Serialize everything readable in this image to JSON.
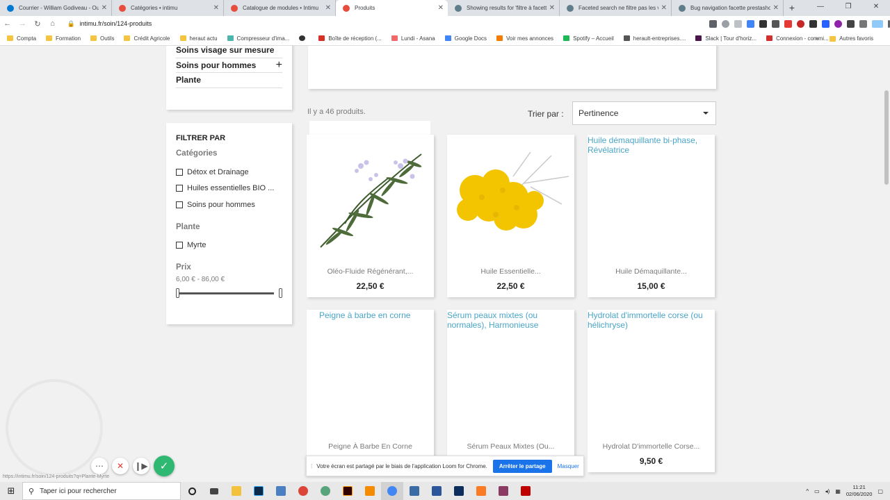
{
  "browser": {
    "tabs": [
      {
        "title": "Courrier - William Godiveau - Ou",
        "color": "#0078d4"
      },
      {
        "title": "Catégories • intimu",
        "color": "#e74c3c"
      },
      {
        "title": "Catalogue de modules • Intimu",
        "color": "#e74c3c"
      },
      {
        "title": "Produits",
        "color": "#e74c3c"
      },
      {
        "title": "Showing results for 'filtre à facett",
        "color": "#607d8b"
      },
      {
        "title": "Faceted search ne filtre pas les var",
        "color": "#607d8b"
      },
      {
        "title": "Bug navigation facette prestasho",
        "color": "#607d8b"
      }
    ],
    "active_tab": 3,
    "url": "intimu.fr/soin/124-produits",
    "bookmarks": [
      "Compta",
      "Formation",
      "Outils",
      "Crédit Agricole",
      "heraut actu",
      "Compresseur d'ima...",
      "",
      "Boîte de réception (...",
      "Lundi - Asana",
      "Google Docs",
      "Voir mes annonces",
      "Spotify – Accueil",
      "herault-entreprises....",
      "Slack | Tour d'horiz...",
      "Connexion - commi..."
    ],
    "bookmarks_more": "»",
    "other_bookmarks": "Autres favoris"
  },
  "categories": [
    "Soins visage sur mesure",
    "Soins pour hommes",
    "Plante"
  ],
  "filters": {
    "heading": "FILTRER PAR",
    "groups": [
      {
        "title": "Catégories",
        "options": [
          "Détox et Drainage",
          "Huiles essentielles BIO ...",
          "Soins pour hommes"
        ]
      },
      {
        "title": "Plante",
        "options": [
          "Myrte"
        ]
      }
    ],
    "price": {
      "title": "Prix",
      "range": "6,00 € - 86,00 €"
    }
  },
  "listing": {
    "count_text": "Il y a 46 produits.",
    "sort_label": "Trier par :",
    "sort_value": "Pertinence"
  },
  "products": [
    {
      "name": "Oléo-Fluide Régénérant,...",
      "price": "22,50 €",
      "image_alt": ""
    },
    {
      "name": "Huile Essentielle...",
      "price": "22,50 €",
      "image_alt": ""
    },
    {
      "name": "Huile Démaquillante...",
      "price": "15,00 €",
      "image_alt": "Huile démaquillante bi-phase, Révélatrice"
    },
    {
      "name": "Peigne À Barbe En Corne",
      "price": "",
      "image_alt": "Peigne à barbe en corne"
    },
    {
      "name": "Sérum Peaux Mixtes (Ou...",
      "price": "",
      "image_alt": "Sérum peaux mixtes (ou normales), Harmonieuse"
    },
    {
      "name": "Hydrolat D'immortelle Corse...",
      "price": "9,50 €",
      "image_alt": "Hydrolat d'immortelle corse (ou hélichryse)"
    }
  ],
  "loom": {
    "message": "Votre écran est partagé par le biais de l'application Loom for Chrome.",
    "stop": "Arrêter le partage",
    "hide": "Masquer"
  },
  "status_url": "https://intimu.fr/soin/124-produits?q=Plante-Myrte",
  "taskbar": {
    "search_placeholder": "Taper ici pour rechercher",
    "time": "11:21",
    "date": "02/06/2020"
  }
}
